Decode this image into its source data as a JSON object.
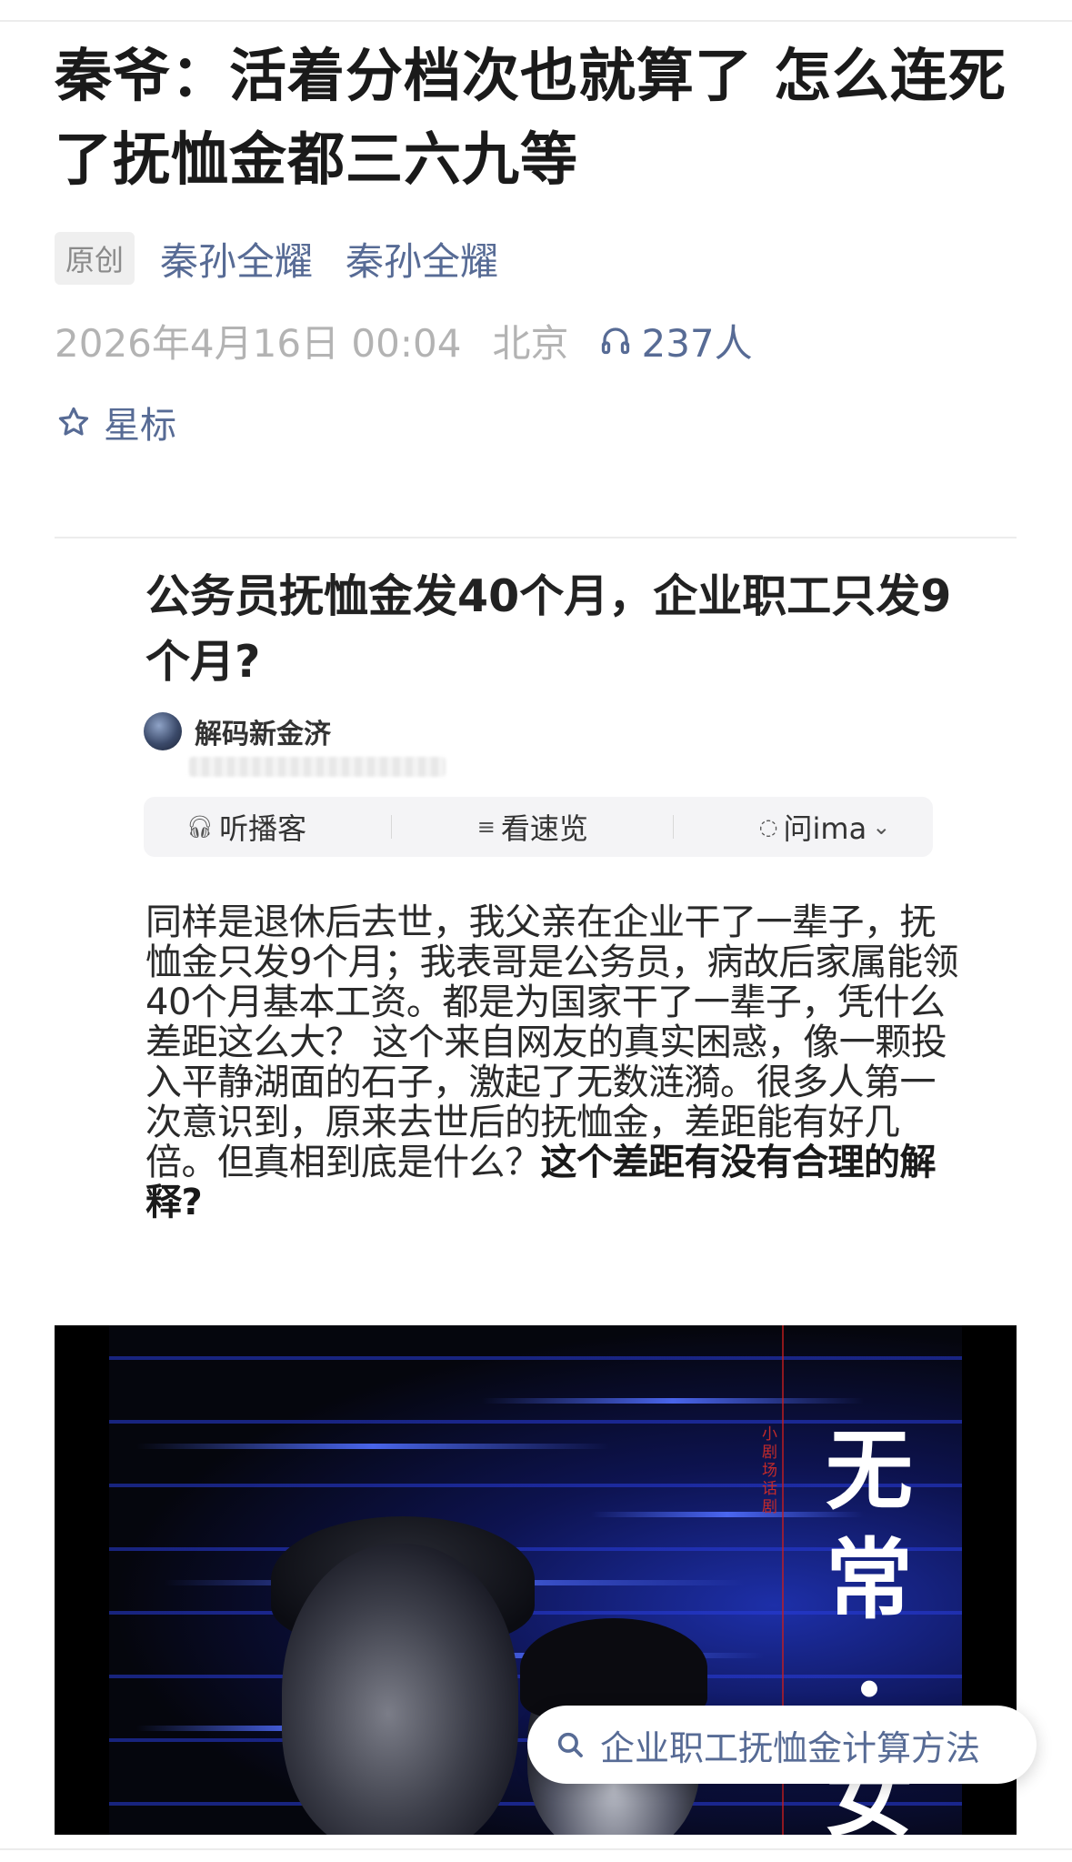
{
  "article": {
    "title": "秦爷：活着分档次也就算了 怎么连死了抚恤金都三六九等",
    "tag": "原创",
    "author_1": "秦孙全耀",
    "author_2": "秦孙全耀",
    "date": "2026年4月16日 00:04",
    "location": "北京",
    "listen_count": "237人",
    "star_label": "星标"
  },
  "embed": {
    "title": "公务员抚恤金发40个月，企业职工只发9个月?",
    "source_name": "解码新金济",
    "toolbar": {
      "podcast": "听播客",
      "overview": "看速览",
      "ask": "问ima"
    },
    "body_plain": "同样是退休后去世，我父亲在企业干了一辈子，抚恤金只发9个月；我表哥是公务员，病故后家属能领40个月基本工资。都是为国家干了一辈子，凭什么差距这么大？ 这个来自网友的真实困惑，像一颗投入平静湖面的石子，激起了无数涟漪。很多人第一次意识到，原来去世后的抚恤金，差距能有好几倍。但真相到底是什么？",
    "body_bold": "这个差距有没有合理的解释?"
  },
  "poster": {
    "title_chars": [
      "无",
      "常",
      "·",
      "女"
    ],
    "subtitle": "小剧场话剧"
  },
  "search_suggestion": "企业职工抚恤金计算方法",
  "colors": {
    "link_blue": "#576b95",
    "meta_gray": "#b3b3b3"
  }
}
